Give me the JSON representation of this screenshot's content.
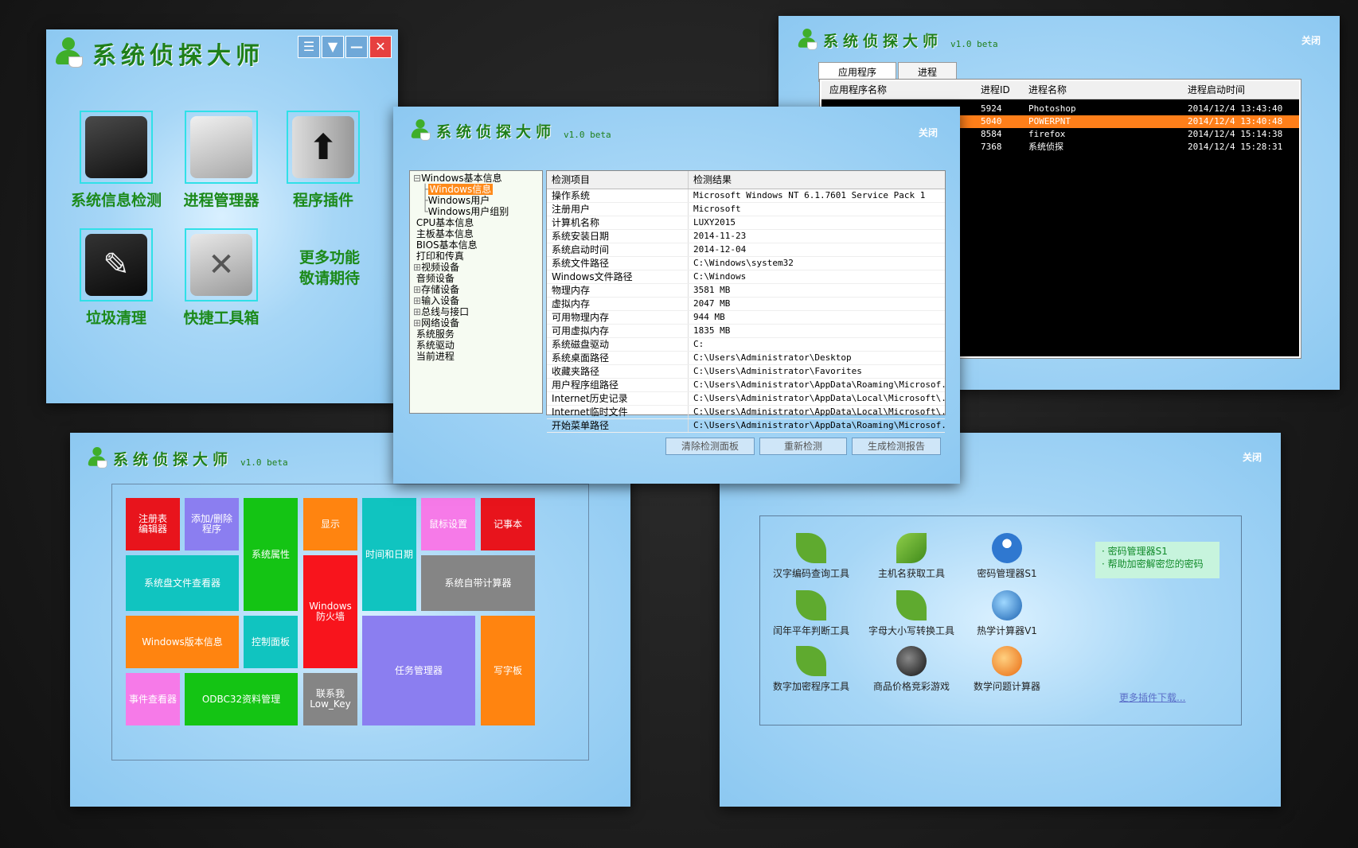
{
  "brand": {
    "title": "系统侦探大师",
    "version": "v1.0 beta"
  },
  "close_label": "关闭",
  "win1": {
    "controls": [
      "☰",
      "▼",
      "—",
      "✕"
    ],
    "tiles": [
      "系统信息检测",
      "进程管理器",
      "程序插件",
      "垃圾清理",
      "快捷工具箱"
    ],
    "more": "更多功能",
    "more2": "敬请期待"
  },
  "win2": {
    "tabs": [
      "应用程序",
      "进程"
    ],
    "headers": [
      "应用程序名称",
      "进程ID",
      "进程名称",
      "进程启动时间"
    ],
    "rows": [
      {
        "app": "",
        "pid": "5924",
        "name": "Photoshop",
        "time": "2014/12/4 13:43:40"
      },
      {
        "app": "",
        "pid": "5040",
        "name": "POWERPNT",
        "time": "2014/12/4 13:40:48"
      },
      {
        "app": "",
        "pid": "8584",
        "name": "firefox",
        "time": "2014/12/4 15:14:38"
      },
      {
        "app": "",
        "pid": "7368",
        "name": "系统侦探",
        "time": "2014/12/4 15:28:31"
      }
    ]
  },
  "win3": {
    "tree": [
      {
        "label": "Windows基本信息",
        "prefix": "⊟"
      },
      {
        "label": "Windows信息",
        "prefix": "   ├",
        "selected": true
      },
      {
        "label": "Windows用户",
        "prefix": "   ├"
      },
      {
        "label": "Windows用户组别",
        "prefix": "   └"
      },
      {
        "label": "CPU基本信息",
        "prefix": " "
      },
      {
        "label": "主板基本信息",
        "prefix": " "
      },
      {
        "label": "BIOS基本信息",
        "prefix": " "
      },
      {
        "label": "打印和传真",
        "prefix": " "
      },
      {
        "label": "视频设备",
        "prefix": "⊞"
      },
      {
        "label": "音频设备",
        "prefix": " "
      },
      {
        "label": "存储设备",
        "prefix": "⊞"
      },
      {
        "label": "输入设备",
        "prefix": "⊞"
      },
      {
        "label": "总线与接口",
        "prefix": "⊞"
      },
      {
        "label": "网络设备",
        "prefix": "⊞"
      },
      {
        "label": "系统服务",
        "prefix": " "
      },
      {
        "label": "系统驱动",
        "prefix": " "
      },
      {
        "label": "当前进程",
        "prefix": " "
      }
    ],
    "headers": [
      "检测项目",
      "检测结果"
    ],
    "rows": [
      {
        "k": "操作系统",
        "v": "Microsoft Windows NT 6.1.7601 Service Pack 1"
      },
      {
        "k": "注册用户",
        "v": "Microsoft"
      },
      {
        "k": "计算机名称",
        "v": "LUXY2015"
      },
      {
        "k": "系统安装日期",
        "v": "2014-11-23"
      },
      {
        "k": "系统启动时间",
        "v": "2014-12-04"
      },
      {
        "k": "系统文件路径",
        "v": "C:\\Windows\\system32"
      },
      {
        "k": "Windows文件路径",
        "v": "C:\\Windows"
      },
      {
        "k": "物理内存",
        "v": "3581 MB"
      },
      {
        "k": "虚拟内存",
        "v": "2047 MB"
      },
      {
        "k": "可用物理内存",
        "v": "944 MB"
      },
      {
        "k": "可用虚拟内存",
        "v": "1835 MB"
      },
      {
        "k": "系统磁盘驱动",
        "v": "C:"
      },
      {
        "k": "系统桌面路径",
        "v": "C:\\Users\\Administrator\\Desktop"
      },
      {
        "k": "收藏夹路径",
        "v": "C:\\Users\\Administrator\\Favorites"
      },
      {
        "k": "用户程序组路径",
        "v": "C:\\Users\\Administrator\\AppData\\Roaming\\Microsof..."
      },
      {
        "k": "Internet历史记录",
        "v": "C:\\Users\\Administrator\\AppData\\Local\\Microsoft\\..."
      },
      {
        "k": "Internet临时文件",
        "v": "C:\\Users\\Administrator\\AppData\\Local\\Microsoft\\..."
      },
      {
        "k": "开始菜单路径",
        "v": "C:\\Users\\Administrator\\AppData\\Roaming\\Microsof..."
      }
    ],
    "buttons": [
      "清除检测面板",
      "重新检测",
      "生成检测报告"
    ]
  },
  "win4": {
    "tiles": [
      {
        "label": "注册表\n编辑器",
        "color": "#e8141c"
      },
      {
        "label": "添加/删除\n程序",
        "color": "#8b7ef0"
      },
      {
        "label": "系统属性",
        "color": "#14c414"
      },
      {
        "label": "显示",
        "color": "#ff8410"
      },
      {
        "label": "时间和日期",
        "color": "#10c4c0"
      },
      {
        "label": "鼠标设置",
        "color": "#f67ae8"
      },
      {
        "label": "记事本",
        "color": "#e8141c"
      },
      {
        "label": "系统盘文件查看器",
        "color": "#10c4c0"
      },
      {
        "label": "Windows\n防火墙",
        "color": "#f8141c"
      },
      {
        "label": "系统自带计算器",
        "color": "#858585"
      },
      {
        "label": "Windows版本信息",
        "color": "#ff8410"
      },
      {
        "label": "控制面板",
        "color": "#10c4c0"
      },
      {
        "label": "任务管理器",
        "color": "#8b7ef0"
      },
      {
        "label": "写字板",
        "color": "#ff8410"
      },
      {
        "label": "事件查看器",
        "color": "#f67ae8"
      },
      {
        "label": "ODBC32资料管理",
        "color": "#14c414"
      },
      {
        "label": "联系我\nLow_Key",
        "color": "#858585"
      }
    ]
  },
  "win5": {
    "plugins": [
      "汉字编码查询工具",
      "主机名获取工具",
      "密码管理器S1",
      "闰年平年判断工具",
      "字母大小写转换工具",
      "热学计算器V1",
      "数字加密程序工具",
      "商品价格竞彩游戏",
      "数学问题计算器"
    ],
    "info": [
      "· 密码管理器S1",
      "· 帮助加密解密您的密码"
    ],
    "more_link": "更多插件下载..."
  }
}
